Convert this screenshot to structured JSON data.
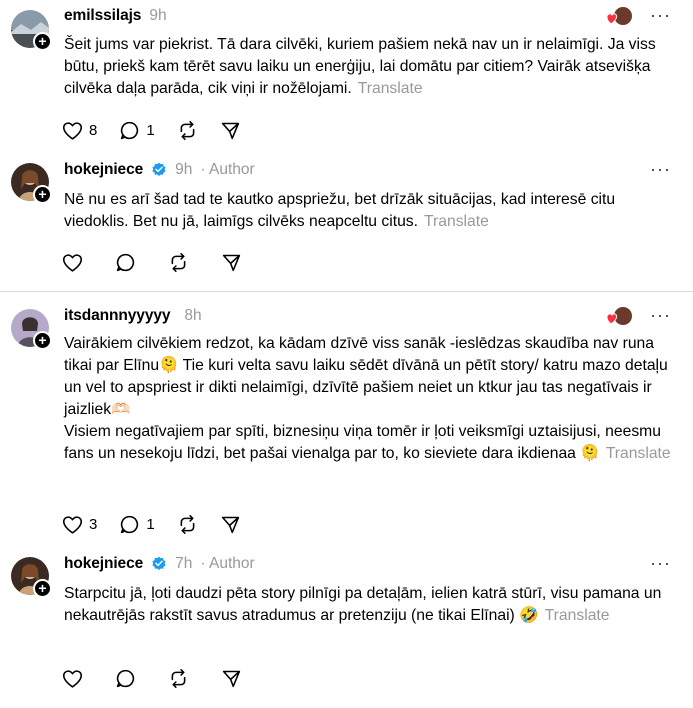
{
  "posts": [
    {
      "username": "emilssilajs",
      "time": "9h",
      "author_tag": "",
      "text": "Šeit jums var piekrist. Tā dara cilvēki, kuriem pašiem nekā nav un ir nelaimīgi. Ja viss būtu, priekš kam tērēt savu laiku un enerģiju, lai domātu par citiem? Vairāk atsevišķa cilvēka daļa parāda, cik viņi ir nožēlojami.",
      "translate": "Translate",
      "likes": "8",
      "replies": "1",
      "liked_by_author": true
    },
    {
      "username": "hokejniece",
      "time": "9h",
      "author_tag": "· Author",
      "text": "Nē nu es arī šad tad te kautko apspriežu, bet drīzāk situācijas, kad interesē citu viedoklis. Bet nu jā, laimīgs cilvēks neapceltu citus.",
      "translate": "Translate",
      "likes": "",
      "replies": "",
      "liked_by_author": false
    },
    {
      "username": "itsdannnyyyyy",
      "time": "8h",
      "author_tag": "",
      "text_line1": "Vairākiem cilvēkiem redzot, ka kādam dzīvē viss sanāk -ieslēdzas skaudība nav runa tikai par Elīnu🫠 Tie kuri velta savu laiku sēdēt dīvānā un pētīt story/ katru mazo detaļu un vel to apspriest ir dikti nelaimīgi, dzīvītē pašiem neiet un ktkur jau tas negatīvais ir jaizliek🫶🏻",
      "text_line2": "Visiem negatīvajiem par spīti, biznesiņu viņa tomēr ir ļoti veiksmīgi uztaisijusi, neesmu fans un nesekoju līdzi, bet pašai vienalga par to, ko sieviete dara ikdienaa 🫠",
      "translate": "Translate",
      "likes": "3",
      "replies": "1",
      "liked_by_author": true
    },
    {
      "username": "hokejniece",
      "time": "7h",
      "author_tag": "· Author",
      "text": "Starpcitu jā, ļoti daudzi pēta story pilnīgi pa detaļām, ielien katrā stūrī, visu pamana un nekautrējās rakstīt savus atradumus ar pretenziju (ne tikai Elīnai) 🤣",
      "translate": "Translate",
      "likes": "",
      "replies": "",
      "liked_by_author": false
    }
  ],
  "icons": {
    "like": "heart-icon",
    "reply": "comment-icon",
    "repost": "repost-icon",
    "share": "send-icon",
    "more": "more-icon",
    "follow": "plus-icon",
    "verified": "verified-badge-icon"
  },
  "colors": {
    "muted": "#999999",
    "verified": "#1d9bf0",
    "heart": "#ff3040"
  }
}
